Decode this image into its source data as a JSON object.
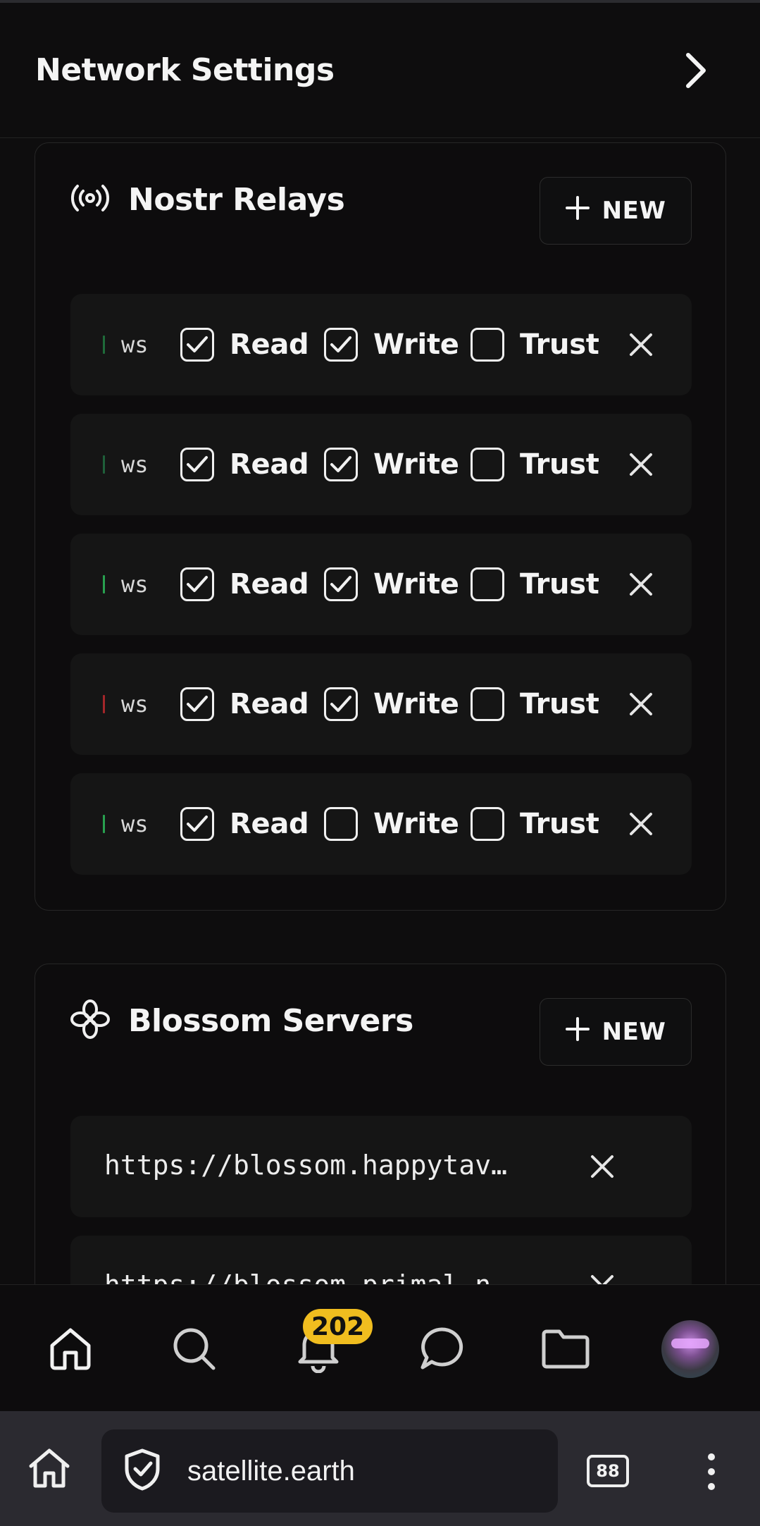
{
  "header": {
    "title": "Network Settings"
  },
  "relays": {
    "title": "Nostr Relays",
    "new_label": "NEW",
    "read_label": "Read",
    "write_label": "Write",
    "trust_label": "Trust",
    "items": [
      {
        "url": "ws",
        "status_color": "#1f6b3a",
        "read": true,
        "write": true,
        "trust": false
      },
      {
        "url": "ws",
        "status_color": "#1f5f3a",
        "read": true,
        "write": true,
        "trust": false
      },
      {
        "url": "ws",
        "status_color": "#28a04f",
        "read": true,
        "write": true,
        "trust": false
      },
      {
        "url": "ws",
        "status_color": "#a3262a",
        "read": true,
        "write": true,
        "trust": false
      },
      {
        "url": "ws",
        "status_color": "#28a04f",
        "read": true,
        "write": false,
        "trust": false
      }
    ]
  },
  "blossom": {
    "title": "Blossom Servers",
    "new_label": "NEW",
    "items": [
      {
        "url": "https://blossom.happytav…"
      },
      {
        "url": "https://blossom.primal.n…"
      }
    ]
  },
  "nav": {
    "notifications_count": "202"
  },
  "browser": {
    "url": "satellite.earth",
    "tab_count": "88"
  },
  "colors": {
    "background": "#0e0d0e",
    "badge": "#f0bd1f",
    "row": "#151515"
  }
}
